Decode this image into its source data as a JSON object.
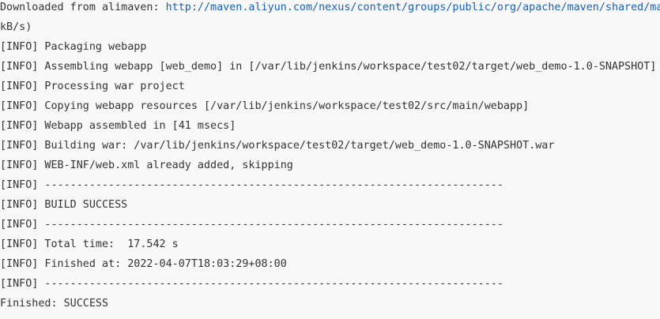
{
  "console": {
    "download": {
      "prefix": "Downloaded from alimaven: ",
      "url": "http://maven.aliyun.com/nexus/content/groups/public/org/apache/maven/shared/maven",
      "continuation": "kB/s)"
    },
    "lines": [
      "[INFO] Packaging webapp",
      "[INFO] Assembling webapp [web_demo] in [/var/lib/jenkins/workspace/test02/target/web_demo-1.0-SNAPSHOT]",
      "[INFO] Processing war project",
      "[INFO] Copying webapp resources [/var/lib/jenkins/workspace/test02/src/main/webapp]",
      "[INFO] Webapp assembled in [41 msecs]",
      "[INFO] Building war: /var/lib/jenkins/workspace/test02/target/web_demo-1.0-SNAPSHOT.war",
      "[INFO] WEB-INF/web.xml already added, skipping",
      "[INFO] ------------------------------------------------------------------------",
      "[INFO] BUILD SUCCESS",
      "[INFO] ------------------------------------------------------------------------",
      "[INFO] Total time:  17.542 s",
      "[INFO] Finished at: 2022-04-07T18:03:29+08:00",
      "[INFO] ------------------------------------------------------------------------",
      "Finished: SUCCESS"
    ]
  }
}
